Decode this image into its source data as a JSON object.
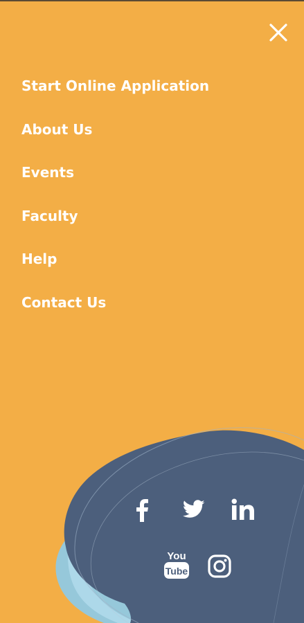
{
  "theme": {
    "background": "#F3AE46",
    "blob_color": "#4C5F7C",
    "accent_light_blue": "#8CCBEA",
    "text_color": "#FFFFFF"
  },
  "close_button": {
    "icon": "close-icon"
  },
  "menu": {
    "items": [
      {
        "label": "Start Online Application"
      },
      {
        "label": "About Us"
      },
      {
        "label": "Events"
      },
      {
        "label": "Faculty"
      },
      {
        "label": "Help"
      },
      {
        "label": "Contact Us"
      }
    ]
  },
  "social": {
    "items": [
      {
        "icon": "facebook-icon"
      },
      {
        "icon": "twitter-icon"
      },
      {
        "icon": "linkedin-icon"
      },
      {
        "icon": "youtube-icon",
        "logo_text": [
          "You",
          "Tube"
        ]
      },
      {
        "icon": "instagram-icon"
      }
    ]
  }
}
